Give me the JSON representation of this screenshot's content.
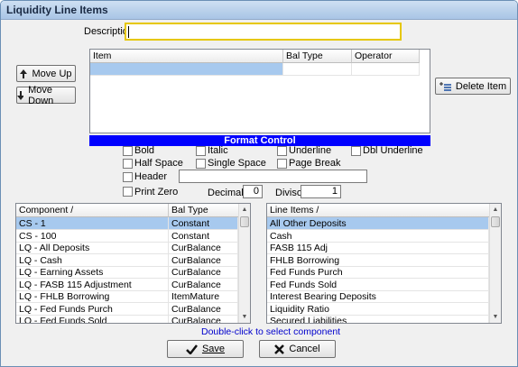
{
  "window": {
    "title": "Liquidity Line Items"
  },
  "description": {
    "label": "Description",
    "value": ""
  },
  "buttons": {
    "move_up": "Move Up",
    "move_down": "Move Down",
    "delete_item": "Delete Item",
    "save": "Save",
    "cancel": "Cancel"
  },
  "items_grid": {
    "columns": [
      "Item",
      "Bal Type",
      "Operator"
    ],
    "rows": [
      [
        "",
        "",
        ""
      ]
    ]
  },
  "format_control": {
    "title": "Format Control",
    "bold": "Bold",
    "italic": "Italic",
    "underline": "Underline",
    "dbl_underline": "Dbl Underline",
    "half_space": "Half Space",
    "single_space": "Single Space",
    "page_break": "Page Break",
    "header": "Header",
    "header_value": "",
    "print_zero": "Print Zero",
    "decimals_label": "Decimals",
    "decimals_value": "0",
    "divisor_label": "Divisor",
    "divisor_value": "1"
  },
  "component_grid": {
    "columns": [
      "Component /",
      "Bal Type"
    ],
    "rows": [
      [
        "CS - 1",
        "Constant"
      ],
      [
        "CS - 100",
        "Constant"
      ],
      [
        "LQ - All Deposits",
        "CurBalance"
      ],
      [
        "LQ - Cash",
        "CurBalance"
      ],
      [
        "LQ - Earning Assets",
        "CurBalance"
      ],
      [
        "LQ - FASB 115 Adjustment",
        "CurBalance"
      ],
      [
        "LQ - FHLB Borrowing",
        "ItemMature"
      ],
      [
        "LQ - Fed Funds Purch",
        "CurBalance"
      ],
      [
        "LQ - Fed Funds Sold",
        "CurBalance"
      ]
    ]
  },
  "lineitems_grid": {
    "columns": [
      "Line Items /"
    ],
    "rows": [
      [
        "All Other Deposits"
      ],
      [
        "Cash"
      ],
      [
        "FASB 115 Adj"
      ],
      [
        "FHLB Borrowing"
      ],
      [
        "Fed Funds Purch"
      ],
      [
        "Fed Funds Sold"
      ],
      [
        "Interest Bearing Deposits"
      ],
      [
        "Liquidity Ratio"
      ],
      [
        "Secured Liabilities"
      ]
    ]
  },
  "hint": "Double-click to select component",
  "colors": {
    "banner": "#0000ff",
    "selection": "#a7c9ee",
    "hint": "#0000cc",
    "focus": "#e6c700"
  },
  "icons": [
    "arrow-up-icon",
    "arrow-down-icon",
    "delete-item-icon",
    "checkmark-icon",
    "x-icon"
  ]
}
